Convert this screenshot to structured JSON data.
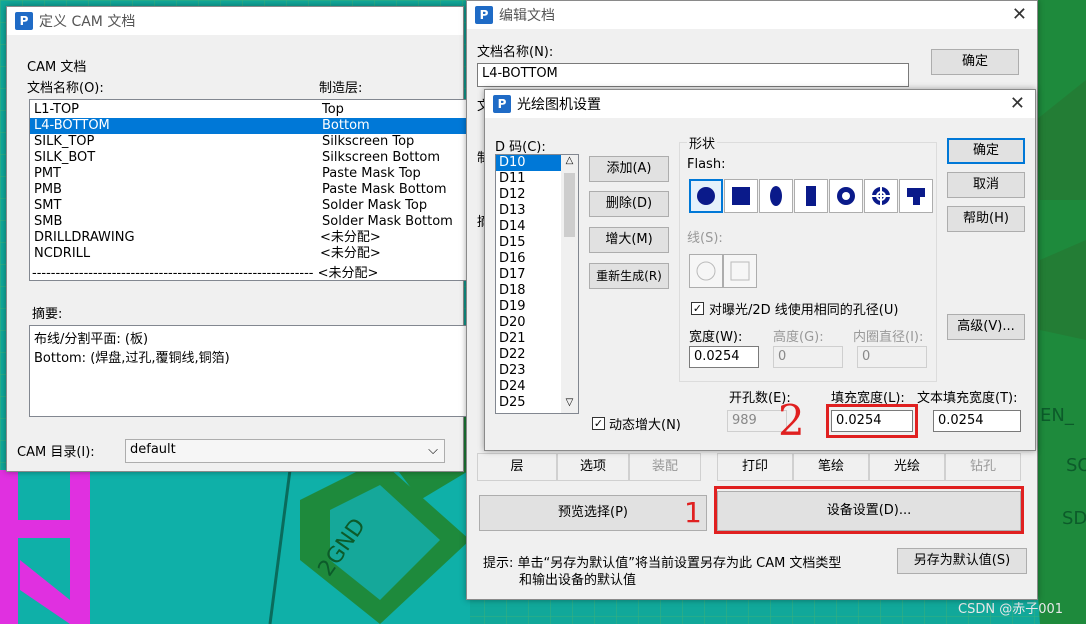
{
  "cam_window": {
    "title": "定义 CAM 文档",
    "group_label": "CAM 文档",
    "col_name": "文档名称(O):",
    "col_layer": "制造层:",
    "docs": [
      {
        "name": "L1-TOP",
        "layer": "Top"
      },
      {
        "name": "L4-BOTTOM",
        "layer": "Bottom"
      },
      {
        "name": "SILK_TOP",
        "layer": "Silkscreen Top"
      },
      {
        "name": "SILK_BOT",
        "layer": "Silkscreen Bottom"
      },
      {
        "name": "PMT",
        "layer": "Paste Mask Top"
      },
      {
        "name": "PMB",
        "layer": "Paste Mask Bottom"
      },
      {
        "name": "SMT",
        "layer": "Solder Mask Top"
      },
      {
        "name": "SMB",
        "layer": "Solder Mask Bottom"
      },
      {
        "name": "DRILLDRAWING",
        "layer": "<未分配>"
      },
      {
        "name": "NCDRILL",
        "layer": "<未分配>"
      }
    ],
    "extra_row": "<未分配>",
    "summary_label": "摘要:",
    "summary_lines": [
      "布线/分割平面: (板)",
      "Bottom: (焊盘,过孔,覆铜线,铜箔)"
    ],
    "dir_label": "CAM 目录(I):",
    "dir_value": "default"
  },
  "edit_window": {
    "title": "编辑文档",
    "doc_name_label": "文档名称(N):",
    "doc_name_value": "L4-BOTTOM",
    "ok": "确定",
    "partial_1": "文",
    "partial_2": "制",
    "partial_3": "摘",
    "tabs_left": [
      "层",
      "选项",
      "装配"
    ],
    "tabs_right": [
      "打印",
      "笔绘",
      "光绘",
      "钻孔"
    ],
    "preview_btn": "预览选择(P)",
    "device_btn": "设备设置(D)...",
    "hint_line1": "提示: 单击“另存为默认值”将当前设置另存为此 CAM 文档类型",
    "hint_line2": "和输出设备的默认值",
    "save_default": "另存为默认值(S)"
  },
  "photo_dialog": {
    "title": "光绘图机设置",
    "dcode_label": "D 码(C):",
    "dcodes": [
      "D10",
      "D11",
      "D12",
      "D13",
      "D14",
      "D15",
      "D16",
      "D17",
      "D18",
      "D19",
      "D20",
      "D21",
      "D22",
      "D23",
      "D24",
      "D25"
    ],
    "add": "添加(A)",
    "delete": "删除(D)",
    "increase": "增大(M)",
    "regenerate": "重新生成(R)",
    "shape_label": "形状",
    "flash_label": "Flash:",
    "line_label": "线(S):",
    "same_aperture": "对曝光/2D 线使用相同的孔径(U)",
    "width_label": "宽度(W):",
    "width_value": "0.0254",
    "height_label": "高度(G):",
    "height_value": "0",
    "inner_label": "内圈直径(I):",
    "inner_value": "0",
    "hole_count_label": "开孔数(E):",
    "hole_count_value": "989",
    "fill_width_label": "填充宽度(L):",
    "fill_width_value": "0.0254",
    "text_fill_label": "文本填充宽度(T):",
    "text_fill_value": "0.0254",
    "dynamic_inc": "动态增大(N)",
    "ok": "确定",
    "cancel": "取消",
    "help": "帮助(H)",
    "advanced": "高级(V)..."
  },
  "annotations": {
    "mark1": "1",
    "mark2": "2",
    "color": "#e02020"
  },
  "pcb_text": {
    "gnd": "2GND",
    "sd": "SD",
    "so": "SO",
    "en": "EN_",
    "watermark": "CSDN @赤子001"
  }
}
